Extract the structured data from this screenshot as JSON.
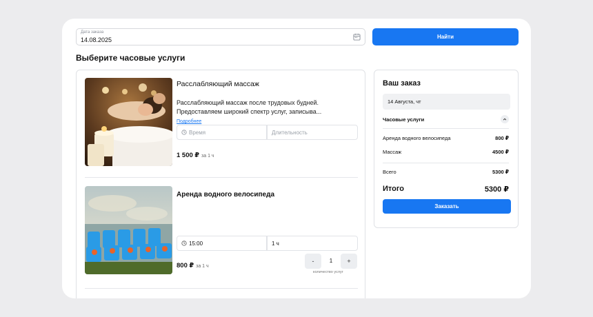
{
  "search": {
    "date_label": "Дата заказа",
    "date_value": "14.08.2025",
    "find_label": "Найти"
  },
  "section_title": "Выберите часовые услуги",
  "services": [
    {
      "name": "Расслабляющий массаж",
      "description": "Расслабляющий массаж после трудовых будней. Предоставляем широкий спектр услуг, записыва...",
      "more_link": "Подробнее",
      "time_placeholder": "Время",
      "duration_placeholder": "Длительность",
      "price": "1 500 ₽",
      "price_unit": "за 1 ч",
      "image_icon": "spa-massage-photo"
    },
    {
      "name": "Аренда водного велосипеда",
      "time_value": "15:00",
      "duration_value": "1 ч",
      "price": "800 ₽",
      "price_unit": "за 1 ч",
      "stepper_minus": "-",
      "stepper_value": "1",
      "stepper_plus": "+",
      "stepper_caption": "количество услуг",
      "image_icon": "pedal-boats-photo"
    }
  ],
  "order": {
    "title": "Ваш заказ",
    "date": "14 Августа, чт",
    "group_label": "Часовые услуги",
    "items": [
      {
        "name": "Аренда водного велосипеда",
        "price": "800 ₽"
      },
      {
        "name": "Массаж",
        "price": "4500 ₽"
      }
    ],
    "sum_label": "Всего",
    "sum_value": "5300 ₽",
    "total_label": "Итого",
    "total_value": "5300 ₽",
    "submit_label": "Заказать"
  },
  "colors": {
    "accent": "#1877f2",
    "background": "#ececee"
  }
}
